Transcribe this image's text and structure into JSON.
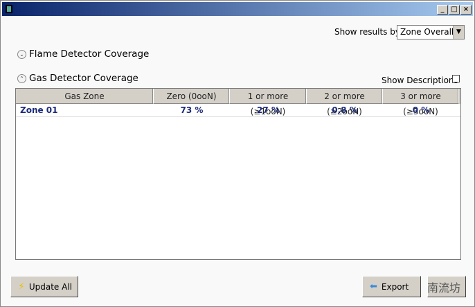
{
  "window": {
    "minimize": "_",
    "maximize": "□",
    "close": "×"
  },
  "filter": {
    "label": "Show results by:",
    "value": "Zone Overall"
  },
  "sections": {
    "flame": "Flame Detector Coverage",
    "gas": "Gas Detector Coverage"
  },
  "show_descriptions": "Show Descriptions",
  "table": {
    "headers": [
      "Gas Zone",
      "Zero (0ooN)",
      "1 or more (≥1ooN)",
      "2 or more (≥2ooN)",
      "3 or more (≥3ooN)"
    ],
    "rows": [
      [
        "Zone 01",
        "73 %",
        "27 %",
        "0.8 %",
        "0 %"
      ]
    ]
  },
  "buttons": {
    "update_all": "Update All",
    "export": "Export"
  },
  "watermark": "南流坊"
}
